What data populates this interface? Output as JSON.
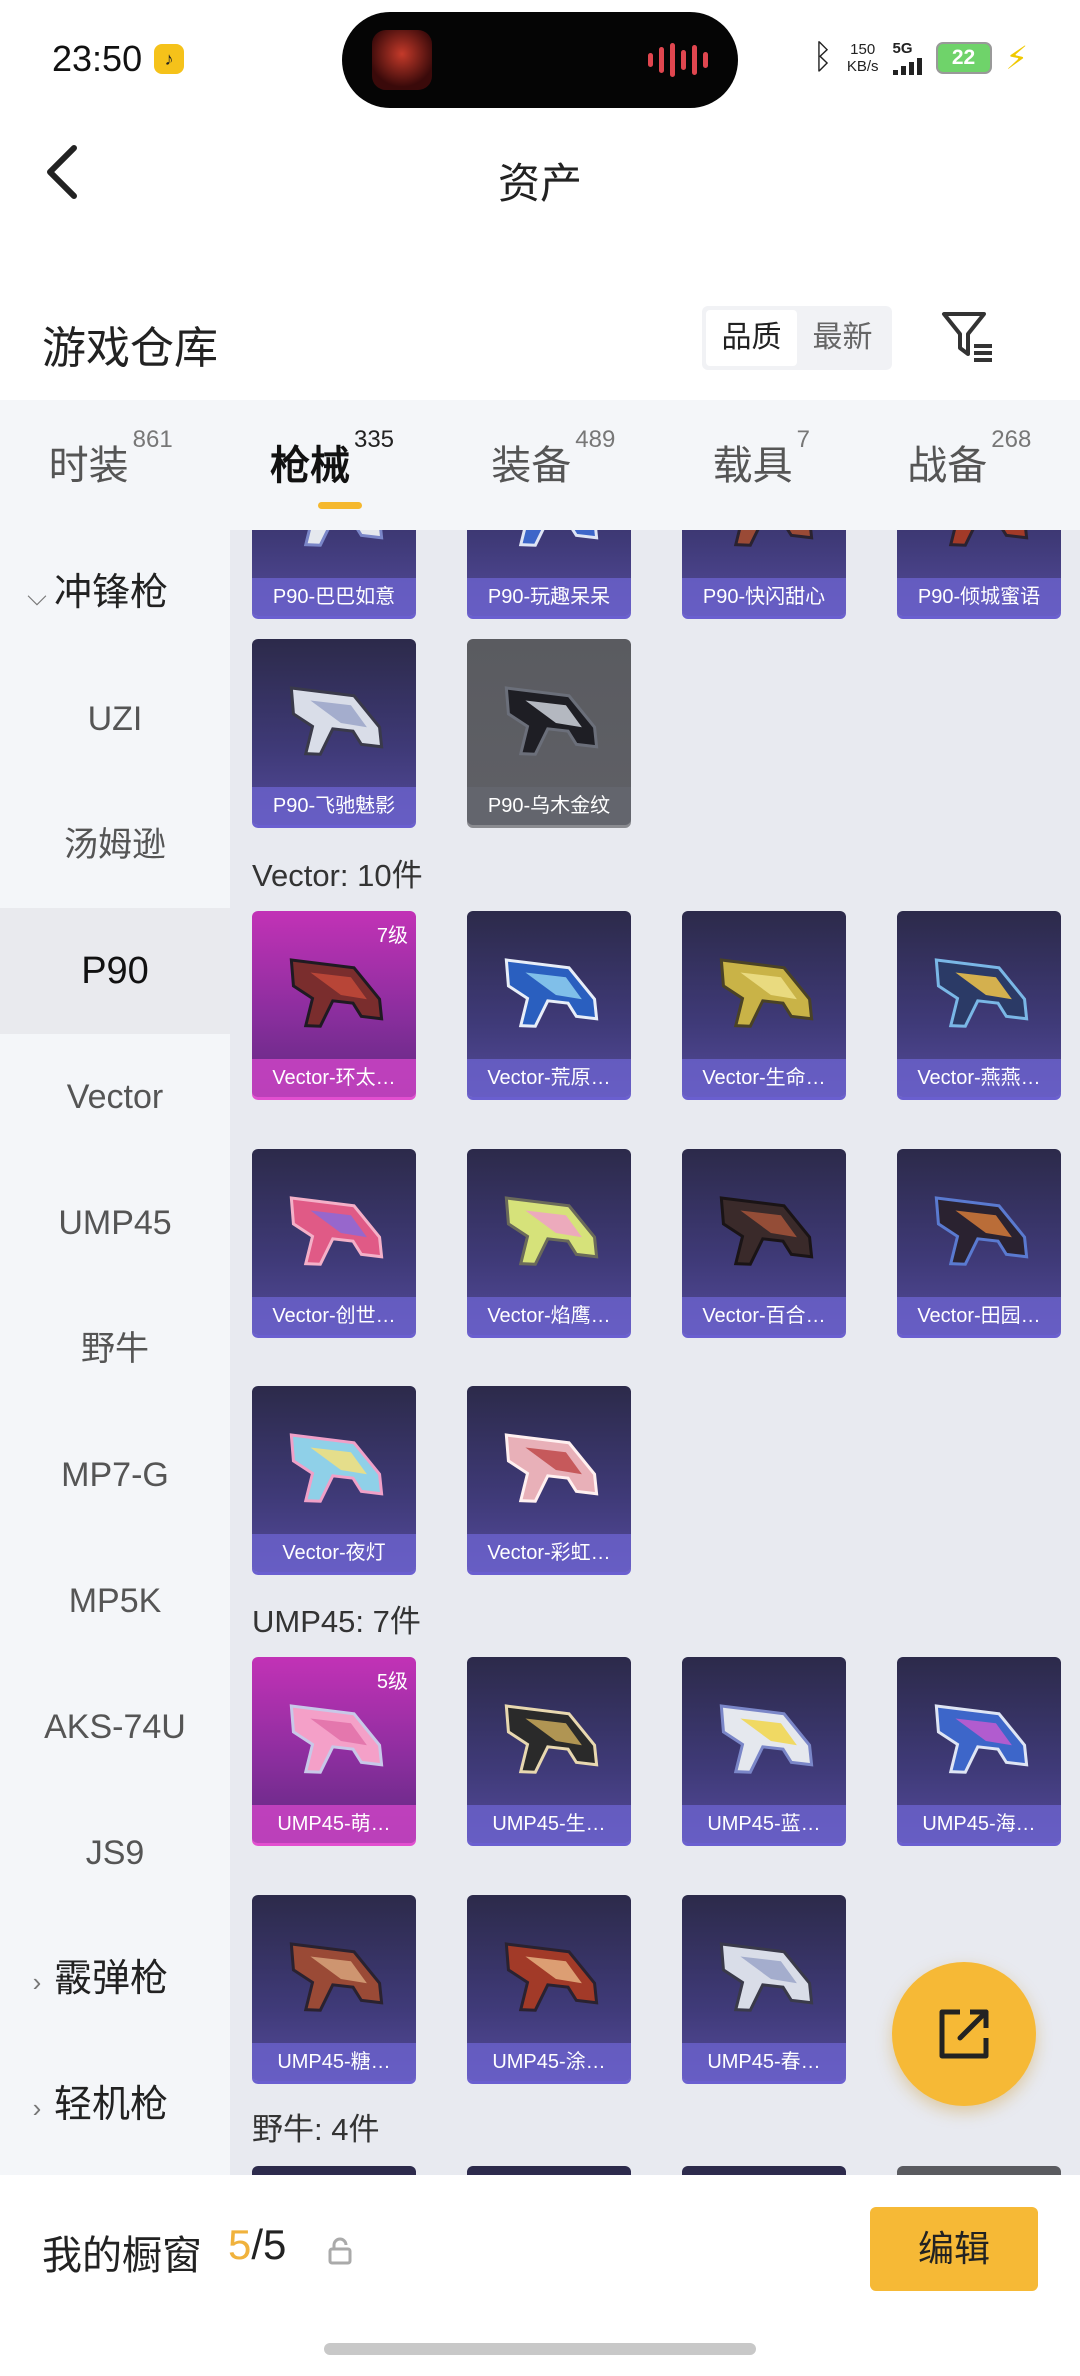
{
  "status_bar": {
    "time": "23:50",
    "speed_value": "150",
    "speed_unit": "KB/s",
    "network": "5G",
    "battery": "22"
  },
  "header": {
    "title": "资产"
  },
  "warehouse": {
    "title": "游戏仓库",
    "sort_options": [
      "品质",
      "最新"
    ],
    "active_sort": "品质"
  },
  "tabs": [
    {
      "label": "时装",
      "count": "861"
    },
    {
      "label": "枪械",
      "count": "335",
      "active": true
    },
    {
      "label": "装备",
      "count": "489"
    },
    {
      "label": "载具",
      "count": "7"
    },
    {
      "label": "战备",
      "count": "268"
    }
  ],
  "sidebar": {
    "groups": [
      {
        "label": "冲锋枪",
        "expanded": true
      },
      {
        "label": "霰弹枪",
        "expanded": false
      },
      {
        "label": "轻机枪",
        "expanded": false
      }
    ],
    "items": [
      "UZI",
      "汤姆逊",
      "P90",
      "Vector",
      "UMP45",
      "野牛",
      "MP7-G",
      "MP5K",
      "AKS-74U",
      "JS9"
    ],
    "active_item": "P90"
  },
  "sections": [
    {
      "title": "",
      "items": [
        {
          "name": "P90-巴巴如意",
          "tier": "purple"
        },
        {
          "name": "P90-玩趣呆呆",
          "tier": "purple"
        },
        {
          "name": "P90-快闪甜心",
          "tier": "purple"
        },
        {
          "name": "P90-倾城蜜语",
          "tier": "purple"
        },
        {
          "name": "P90-飞驰魅影",
          "tier": "purple"
        },
        {
          "name": "P90-乌木金纹",
          "tier": "grey"
        }
      ]
    },
    {
      "title": "Vector: 10件",
      "items": [
        {
          "name": "Vector-环太…",
          "tier": "gold",
          "level": "7级"
        },
        {
          "name": "Vector-荒原…",
          "tier": "purple"
        },
        {
          "name": "Vector-生命…",
          "tier": "purple"
        },
        {
          "name": "Vector-燕燕…",
          "tier": "purple"
        },
        {
          "name": "Vector-创世…",
          "tier": "purple"
        },
        {
          "name": "Vector-焰鹰…",
          "tier": "purple"
        },
        {
          "name": "Vector-百合…",
          "tier": "purple"
        },
        {
          "name": "Vector-田园…",
          "tier": "purple"
        },
        {
          "name": "Vector-夜灯",
          "tier": "purple"
        },
        {
          "name": "Vector-彩虹…",
          "tier": "purple"
        }
      ]
    },
    {
      "title": "UMP45: 7件",
      "items": [
        {
          "name": "UMP45-萌…",
          "tier": "gold",
          "level": "5级"
        },
        {
          "name": "UMP45-生…",
          "tier": "purple"
        },
        {
          "name": "UMP45-蓝…",
          "tier": "purple"
        },
        {
          "name": "UMP45-海…",
          "tier": "purple"
        },
        {
          "name": "UMP45-糖…",
          "tier": "purple"
        },
        {
          "name": "UMP45-涂…",
          "tier": "purple"
        },
        {
          "name": "UMP45-春…",
          "tier": "purple"
        }
      ]
    },
    {
      "title": "野牛: 4件",
      "items": []
    }
  ],
  "showcase": {
    "label": "我的橱窗",
    "current": "5",
    "separator": "/",
    "max": "5",
    "edit_label": "编辑"
  },
  "colors": {
    "accent": "#f6b936",
    "purple_card": "#3f3a78",
    "gold_card": "#c232b6",
    "grey_card": "#5f6066"
  }
}
